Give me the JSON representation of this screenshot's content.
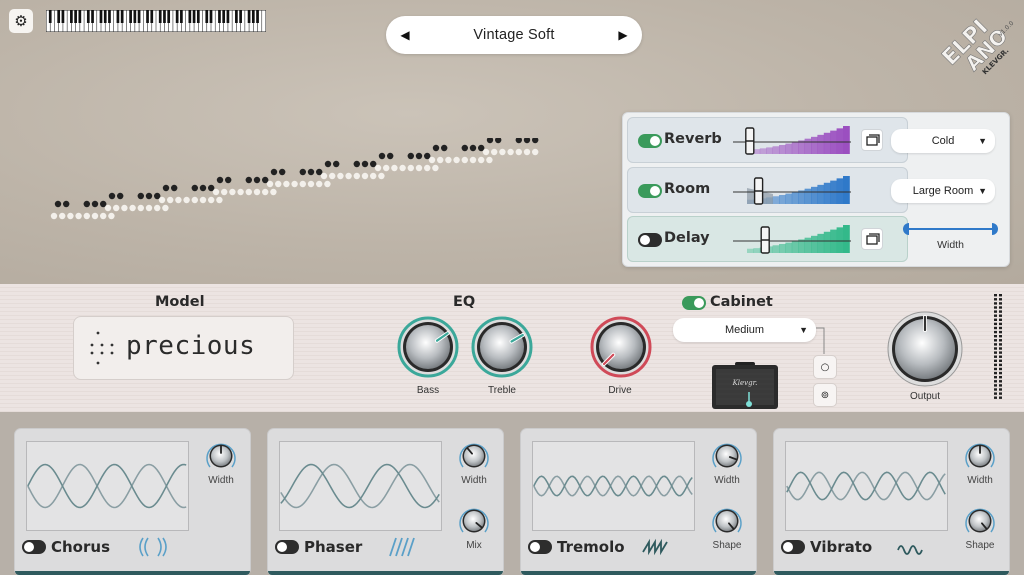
{
  "header": {
    "preset_name": "Vintage Soft",
    "prev_arrow": "◀",
    "next_arrow": "▶",
    "settings_icon": "⚙",
    "logo_letters_1": "ELPI",
    "logo_letters_2": "ANO",
    "logo_brand": "KLEVGR.",
    "version": "v1.0.0"
  },
  "fx": {
    "reverb": {
      "label": "Reverb",
      "enabled": true,
      "mode": "Cold",
      "level": 0.08,
      "color": "#9b4fc0"
    },
    "room": {
      "label": "Room",
      "enabled": true,
      "mode": "Large Room",
      "level": 0.16,
      "color": "#2f79c9"
    },
    "delay": {
      "label": "Delay",
      "enabled": false,
      "level": 0.22,
      "color": "#33b98a"
    },
    "width": {
      "label": "Width"
    },
    "caret": "▼"
  },
  "model": {
    "title": "Model",
    "name": "precious"
  },
  "eq": {
    "title": "EQ",
    "bass": {
      "label": "Bass",
      "accent": "#3ba89a"
    },
    "treble": {
      "label": "Treble",
      "accent": "#3ba89a"
    },
    "drive": {
      "label": "Drive",
      "accent": "#d04a58"
    }
  },
  "cabinet": {
    "title": "Cabinet",
    "enabled": true,
    "type": "Medium",
    "caret": "▼",
    "amp_brand": "Klevgr.",
    "mic_single": "○",
    "mic_double": "⊚"
  },
  "output": {
    "label": "Output"
  },
  "modules": [
    {
      "name": "Chorus",
      "enabled": false,
      "knob1": "Width",
      "icon": "chorus-icon"
    },
    {
      "name": "Phaser",
      "enabled": false,
      "knob1": "Width",
      "knob2": "Mix",
      "icon": "phaser-icon"
    },
    {
      "name": "Tremolo",
      "enabled": false,
      "knob1": "Width",
      "knob2": "Shape",
      "icon": "tremolo-icon"
    },
    {
      "name": "Vibrato",
      "enabled": false,
      "knob1": "Width",
      "knob2": "Shape",
      "icon": "vibrato-icon"
    }
  ]
}
